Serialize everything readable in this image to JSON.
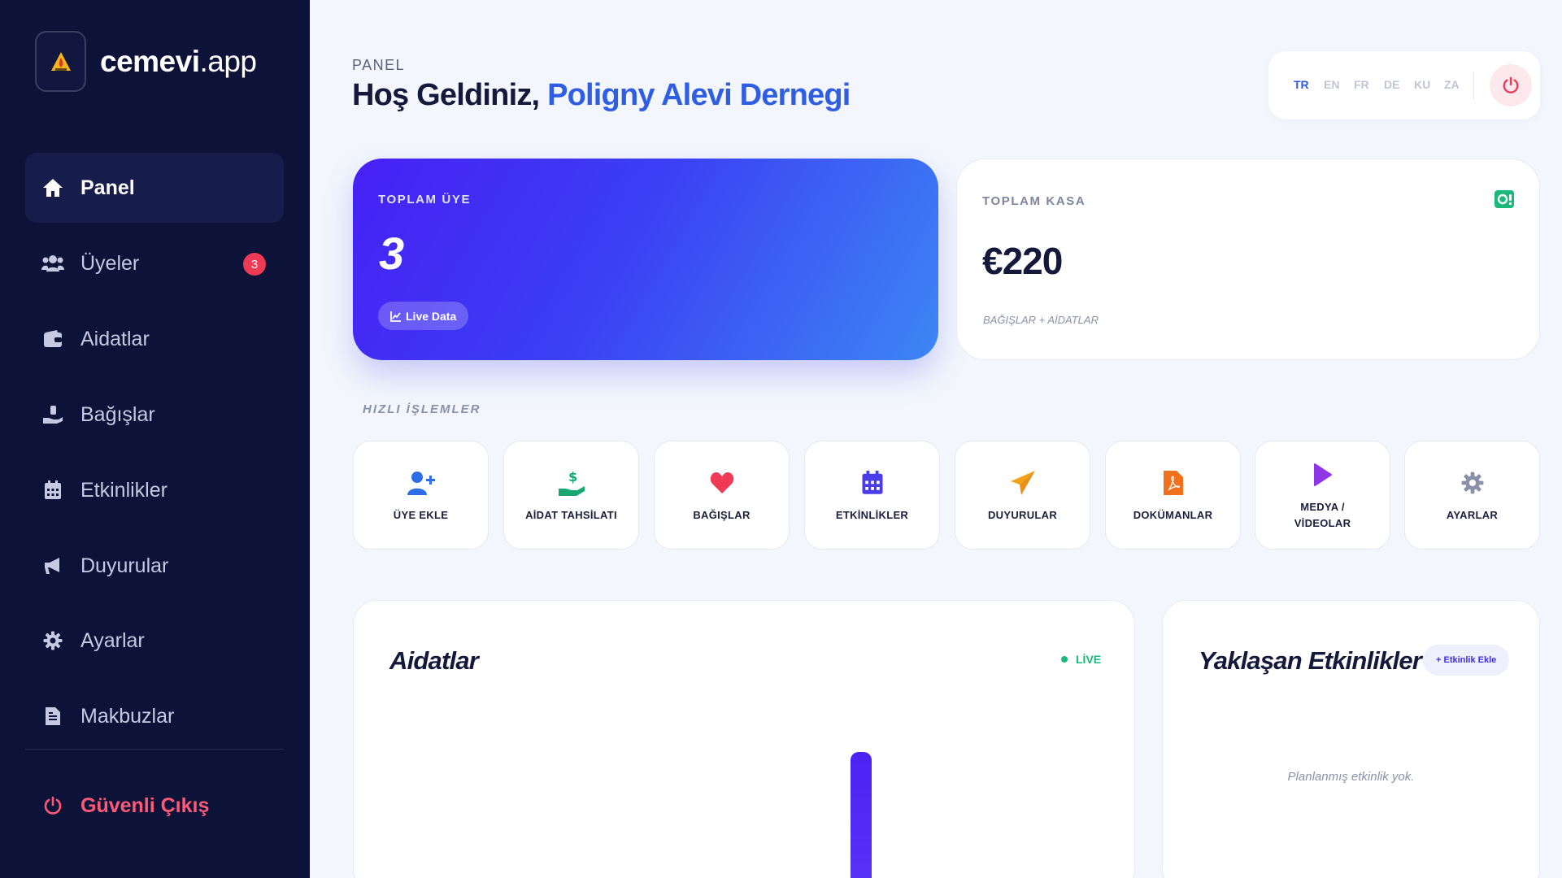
{
  "brand": {
    "bold": "cemevi",
    "light": ".app"
  },
  "sidebar": {
    "items": [
      {
        "label": "Panel",
        "icon": "home-icon"
      },
      {
        "label": "Üyeler",
        "icon": "users-icon",
        "badge": "3"
      },
      {
        "label": "Aidatlar",
        "icon": "wallet-icon"
      },
      {
        "label": "Bağışlar",
        "icon": "donation-icon"
      },
      {
        "label": "Etkinlikler",
        "icon": "calendar-icon"
      },
      {
        "label": "Duyurular",
        "icon": "megaphone-icon"
      },
      {
        "label": "Ayarlar",
        "icon": "gear-icon"
      },
      {
        "label": "Makbuzlar",
        "icon": "receipt-icon"
      }
    ],
    "logout": "Güvenli Çıkış"
  },
  "header": {
    "section": "PANEL",
    "welcome": "Hoş Geldiniz,",
    "org": "Poligny Alevi Dernegi"
  },
  "languages": {
    "items": [
      "TR",
      "EN",
      "FR",
      "DE",
      "KU",
      "ZA"
    ],
    "active": "TR"
  },
  "stats": {
    "members": {
      "label": "TOPLAM ÜYE",
      "value": "3",
      "pill": "Live Data"
    },
    "cash": {
      "label": "TOPLAM KASA",
      "value": "€220",
      "sub": "BAĞIŞLAR + AİDATLAR"
    }
  },
  "quick": {
    "title": "HIZLI İŞLEMLER",
    "items": [
      {
        "label": "ÜYE EKLE",
        "icon": "user-plus-icon"
      },
      {
        "label": "AİDAT TAHSİLATI",
        "icon": "hand-dollar-icon"
      },
      {
        "label": "BAĞIŞLAR",
        "icon": "heart-icon"
      },
      {
        "label": "ETKİNLİKLER",
        "icon": "calendar-icon"
      },
      {
        "label": "DUYURULAR",
        "icon": "paper-plane-icon"
      },
      {
        "label": "DOKÜMANLAR",
        "icon": "pdf-file-icon"
      },
      {
        "label": "MEDYA /\nVİDEOLAR",
        "icon": "play-icon"
      },
      {
        "label": "AYARLAR",
        "icon": "gear-icon"
      }
    ]
  },
  "aidatlar": {
    "title": "Aidatlar",
    "live": "LİVE"
  },
  "events": {
    "title": "Yaklaşan Etkinlikler",
    "add": "+ Etkinlik Ekle",
    "empty": "Planlanmış etkinlik yok."
  },
  "colors": {
    "sidebar": "#0d1238",
    "accent": "#2f5ee3",
    "danger": "#ef3a56",
    "live": "#1ab87a"
  }
}
